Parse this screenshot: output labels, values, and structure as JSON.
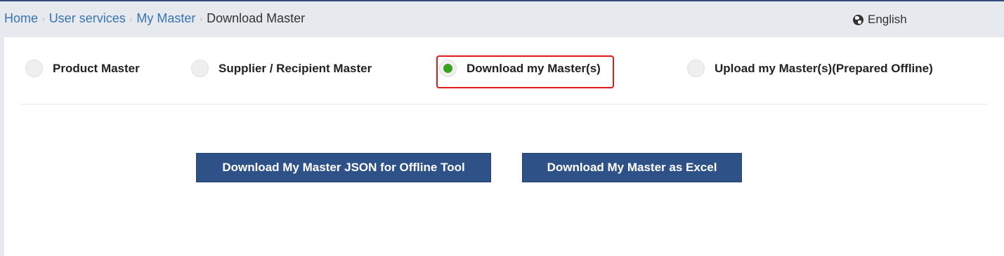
{
  "breadcrumb": {
    "items": [
      "Home",
      "User services",
      "My Master"
    ],
    "current": "Download Master",
    "separator": "›"
  },
  "language": {
    "icon": "globe-icon",
    "label": "English"
  },
  "radio_options": [
    {
      "label": "Product Master",
      "checked": false
    },
    {
      "label": "Supplier / Recipient Master",
      "checked": false
    },
    {
      "label": "Download my Master(s)",
      "checked": true
    },
    {
      "label": "Upload my Master(s)(Prepared Offline)",
      "checked": false
    }
  ],
  "buttons": {
    "json_label": "Download My Master JSON for Offline Tool",
    "excel_label": "Download My Master as Excel"
  },
  "colors": {
    "accent": "#2e5287",
    "link": "#3a73b2",
    "selected_radio": "#3aa01f",
    "highlight": "#e01b1b"
  }
}
